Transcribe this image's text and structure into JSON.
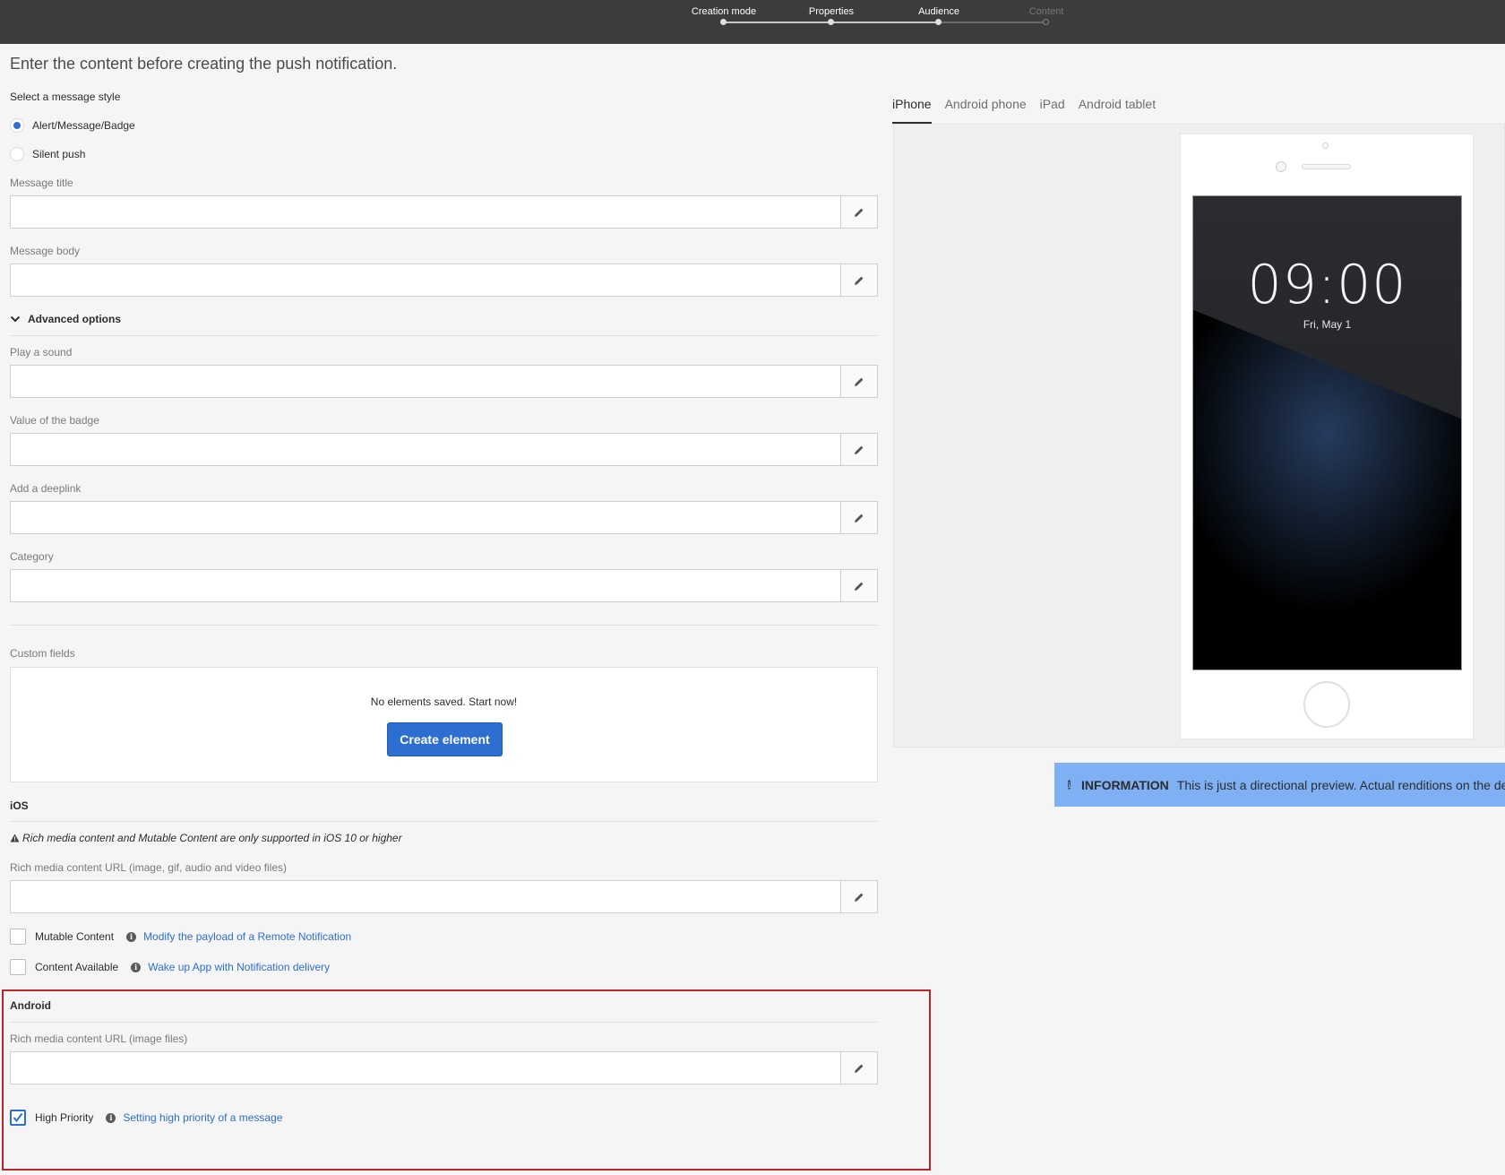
{
  "steps": [
    {
      "label": "Creation mode",
      "state": "done"
    },
    {
      "label": "Properties",
      "state": "done"
    },
    {
      "label": "Audience",
      "state": "done"
    },
    {
      "label": "Content",
      "state": "current"
    }
  ],
  "page": {
    "heading": "Enter the content before creating the push notification."
  },
  "message_style": {
    "label": "Select a message style",
    "options": [
      {
        "label": "Alert/Message/Badge",
        "selected": true
      },
      {
        "label": "Silent push",
        "selected": false
      }
    ]
  },
  "fields": {
    "message_title": {
      "label": "Message title",
      "value": ""
    },
    "message_body": {
      "label": "Message body",
      "value": ""
    },
    "play_sound": {
      "label": "Play a sound",
      "value": ""
    },
    "badge_value": {
      "label": "Value of the badge",
      "value": ""
    },
    "deeplink": {
      "label": "Add a deeplink",
      "value": ""
    },
    "category": {
      "label": "Category",
      "value": ""
    }
  },
  "advanced": {
    "title": "Advanced options"
  },
  "custom_fields": {
    "label": "Custom fields",
    "empty_text": "No elements saved. Start now!",
    "create_button": "Create element"
  },
  "ios": {
    "title": "iOS",
    "warning": "Rich media content and Mutable Content are only supported in iOS 10 or higher",
    "rich_media": {
      "label": "Rich media content URL (image, gif, audio and video files)",
      "value": ""
    },
    "mutable": {
      "label": "Mutable Content",
      "checked": false,
      "help_link": "Modify the payload of a Remote Notification"
    },
    "content_available": {
      "label": "Content Available",
      "checked": false,
      "help_link": "Wake up App with Notification delivery"
    }
  },
  "android": {
    "title": "Android",
    "rich_media": {
      "label": "Rich media content URL (image files)",
      "value": ""
    },
    "high_priority": {
      "label": "High Priority",
      "checked": true,
      "help_link": "Setting high priority of a message"
    }
  },
  "preview": {
    "tabs": [
      {
        "label": "iPhone",
        "active": true
      },
      {
        "label": "Android phone",
        "active": false
      },
      {
        "label": "iPad",
        "active": false
      },
      {
        "label": "Android tablet",
        "active": false
      }
    ],
    "clock": "09:00",
    "date": "Fri, May 1",
    "info_title": "INFORMATION",
    "info_text": "This is just a directional preview. Actual renditions on the de"
  },
  "colors": {
    "accent": "#2d6ed1",
    "info_bar": "#7fb0f4",
    "highlight_border": "#b8262b",
    "topbar": "#3c3c3c"
  },
  "icons": {
    "edit": "pencil-icon",
    "info": "info-icon",
    "warning": "warning-icon",
    "collapse": "chevron-down-icon"
  }
}
